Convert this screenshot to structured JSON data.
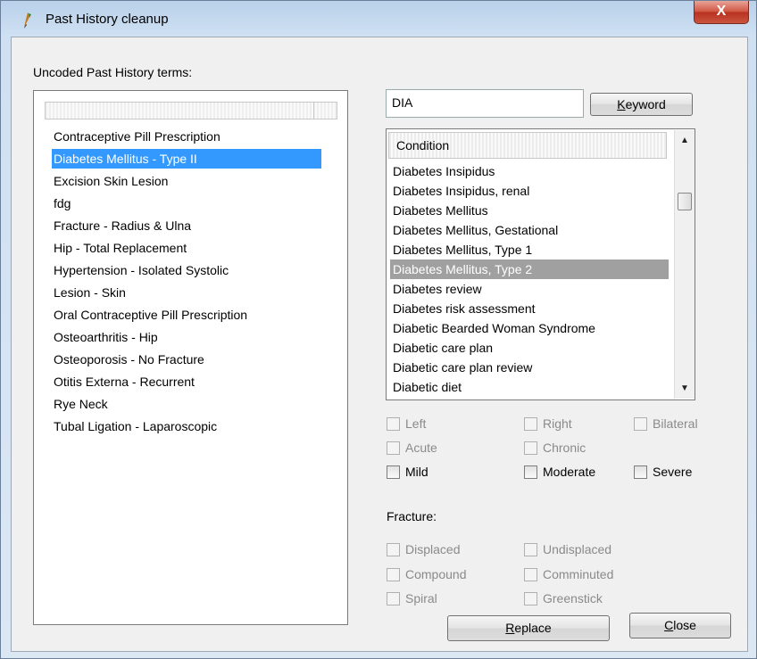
{
  "window": {
    "title": "Past History cleanup",
    "close_glyph": "X"
  },
  "left": {
    "heading": "Uncoded Past History terms:",
    "items": [
      "Contraceptive Pill Prescription",
      "Diabetes Mellitus - Type II",
      "Excision Skin Lesion",
      "fdg",
      "Fracture - Radius & Ulna",
      "Hip - Total Replacement",
      "Hypertension - Isolated Systolic",
      "Lesion - Skin",
      "Oral Contraceptive Pill Prescription",
      "Osteoarthritis - Hip",
      "Osteoporosis - No Fracture",
      "Otitis Externa - Recurrent",
      "Rye Neck",
      "Tubal Ligation - Laparoscopic"
    ],
    "selected_index": 1
  },
  "search": {
    "value": "DIA",
    "keyword_label_prefix": "K",
    "keyword_label_rest": "eyword"
  },
  "conditions": {
    "header": "Condition",
    "items": [
      "Diabetes Insipidus",
      "Diabetes Insipidus, renal",
      "Diabetes Mellitus",
      "Diabetes Mellitus, Gestational",
      "Diabetes Mellitus, Type 1",
      "Diabetes Mellitus, Type 2",
      "Diabetes review",
      "Diabetes risk assessment",
      "Diabetic Bearded Woman Syndrome",
      "Diabetic care plan",
      "Diabetic care plan review",
      "Diabetic diet"
    ],
    "selected_index": 5
  },
  "modifiers": {
    "left": "Left",
    "right": "Right",
    "bilateral": "Bilateral",
    "acute": "Acute",
    "chronic": "Chronic",
    "mild": "Mild",
    "moderate": "Moderate",
    "severe": "Severe"
  },
  "fracture": {
    "heading": "Fracture:",
    "displaced": "Displaced",
    "undisplaced": "Undisplaced",
    "compound": "Compound",
    "comminuted": "Comminuted",
    "spiral": "Spiral",
    "greenstick": "Greenstick"
  },
  "buttons": {
    "replace_prefix": "R",
    "replace_rest": "eplace",
    "close_prefix": "C",
    "close_rest": "lose"
  },
  "colors": {
    "selection_left": "#3399ff",
    "selection_condition": "#a0a0a0",
    "close_button": "#c9553f"
  },
  "icons": {
    "app": "app-icon",
    "scroll_up": "scroll-up-arrow-icon",
    "scroll_down": "scroll-down-arrow-icon"
  }
}
